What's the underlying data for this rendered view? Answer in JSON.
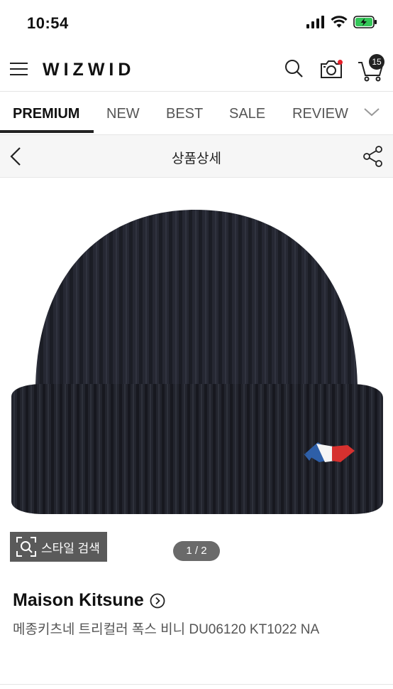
{
  "status_bar": {
    "time": "10:54"
  },
  "header": {
    "logo": "WIZWID",
    "cart_count": "15"
  },
  "tabs": [
    {
      "label": "PREMIUM",
      "active": true
    },
    {
      "label": "NEW"
    },
    {
      "label": "BEST"
    },
    {
      "label": "SALE"
    },
    {
      "label": "REVIEW"
    }
  ],
  "subheader": {
    "title": "상품상세"
  },
  "gallery": {
    "style_search_label": "스타일 검색",
    "pager": "1 / 2"
  },
  "product": {
    "brand": "Maison Kitsune",
    "name": "메종키츠네 트리컬러 폭스 비니 DU06120 KT1022 NA"
  },
  "colors": {
    "accent_dot": "#e6202a",
    "hat": "#23252e",
    "badge": "#222222"
  }
}
